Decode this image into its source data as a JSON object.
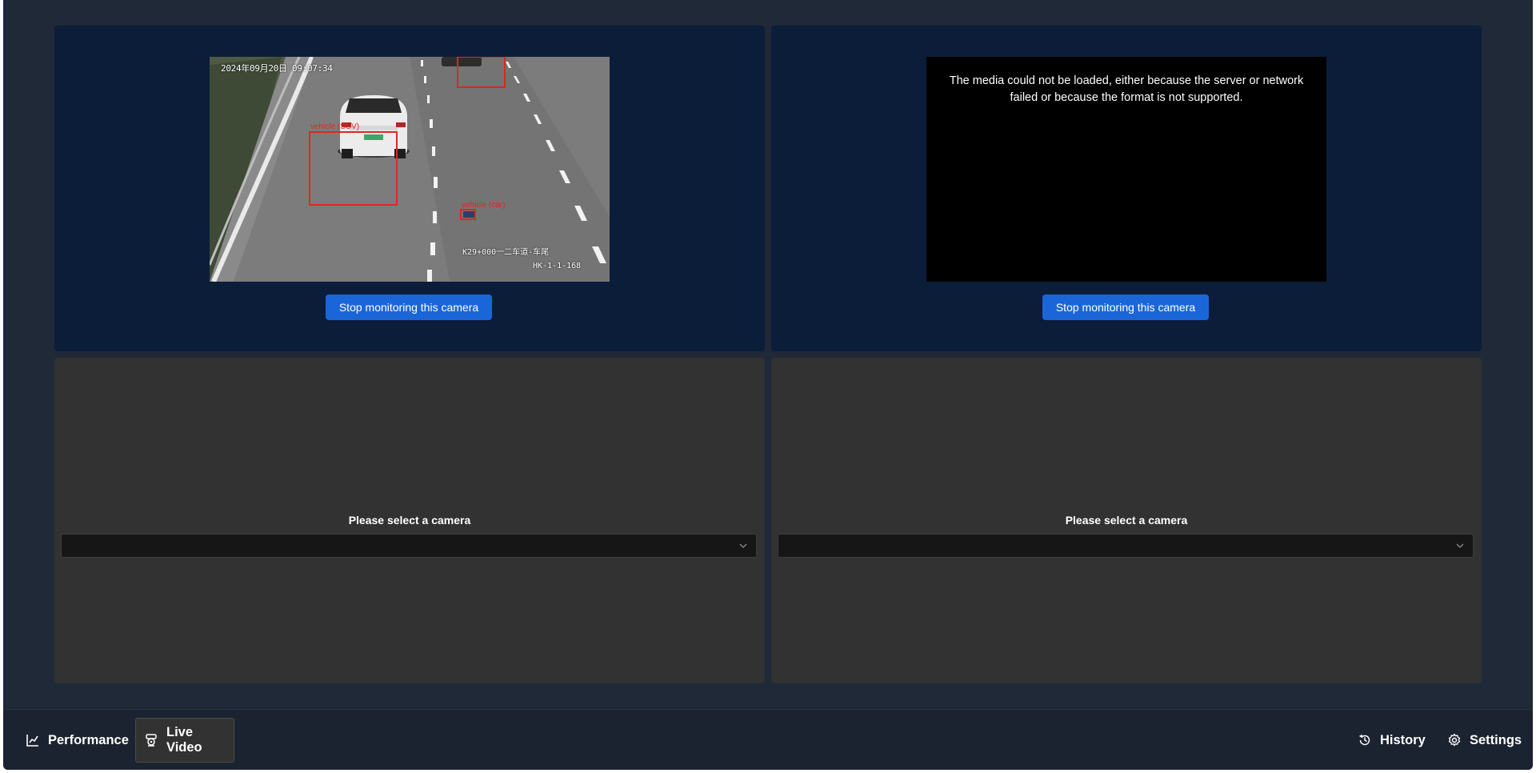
{
  "panels": [
    {
      "state": "playing",
      "overlay": {
        "timestamp": "2024年09月20日 09:07:34",
        "detections": [
          {
            "label": "vehicle (SUV)"
          },
          {
            "label": "vehicle (car)"
          }
        ],
        "caption_line1": "K29+000一二车道-车尾",
        "caption_line2": "HK-1-1-168"
      },
      "button_label": "Stop monitoring this camera"
    },
    {
      "state": "error",
      "error_message": "The media could not be loaded, either because the server or network failed or because the format is not supported.",
      "button_label": "Stop monitoring this camera"
    },
    {
      "state": "empty",
      "prompt": "Please select a camera",
      "selected_value": ""
    },
    {
      "state": "empty",
      "prompt": "Please select a camera",
      "selected_value": ""
    }
  ],
  "nav": {
    "left": [
      {
        "label": "Performance",
        "icon": "chart-line-icon",
        "selected": false
      },
      {
        "label": "Live Video",
        "icon": "webcam-icon",
        "selected": true
      }
    ],
    "right": [
      {
        "label": "History",
        "icon": "history-icon"
      },
      {
        "label": "Settings",
        "icon": "gear-icon"
      }
    ]
  },
  "colors": {
    "app_bg": "#1f2937",
    "active_panel": "#0c1d3a",
    "empty_panel": "#323232",
    "primary_button": "#1a66d9",
    "detection_box": "#e0261f"
  }
}
